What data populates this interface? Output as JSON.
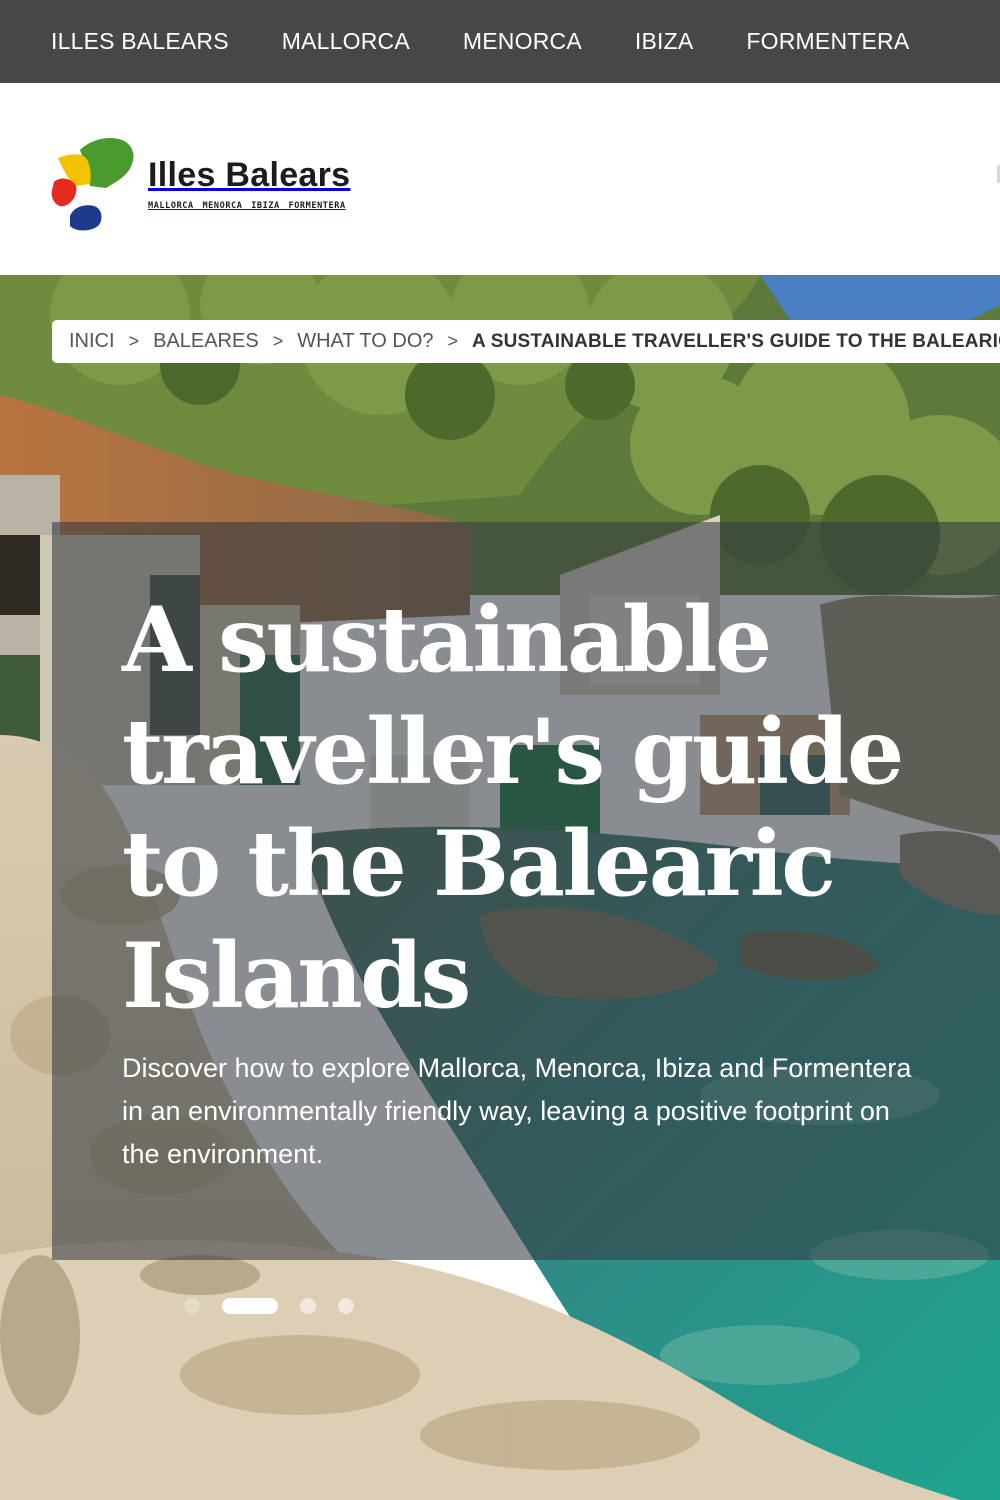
{
  "top_nav": {
    "items": [
      {
        "label": "ILLES BALEARS"
      },
      {
        "label": "MALLORCA"
      },
      {
        "label": "MENORCA"
      },
      {
        "label": "IBIZA"
      },
      {
        "label": "FORMENTERA"
      }
    ],
    "background": "#474747"
  },
  "logo": {
    "title": "Illes Balears",
    "subtitle": "MALLORCA MENORCA IBIZA FORMENTERA",
    "colors": [
      "#4a9b2e",
      "#f2c200",
      "#e52a1e",
      "#1c3b8c"
    ]
  },
  "breadcrumb": {
    "items": [
      {
        "label": "INICI"
      },
      {
        "label": "BALEARES"
      },
      {
        "label": "WHAT TO DO?"
      }
    ],
    "separator": ">",
    "current": "A SUSTAINABLE TRAVELLER'S GUIDE TO THE BALEARIC ISLANDS"
  },
  "hero": {
    "title": "A sustainable traveller's guide to the Balearic Islands",
    "description": "Discover how to explore Mallorca, Menorca, Ibiza and Formentera in an environmentally friendly way, leaving a positive footprint on the environment.",
    "slides": {
      "count": 4,
      "active_index": 1
    },
    "image_icon": "cove-landscape-photo"
  }
}
